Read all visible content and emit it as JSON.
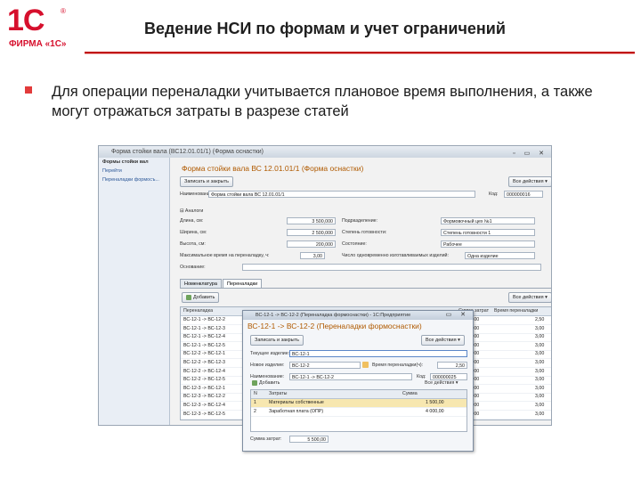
{
  "logo": {
    "brand": "1С",
    "reg_mark": "®",
    "subtitle": "ФИРМА «1С»"
  },
  "slide": {
    "title": "Ведение НСИ по формам и учет ограничений",
    "bullet": "Для операции переналадки учитывается плановое время выполнения, а также могут отражаться затраты в разрезе статей"
  },
  "window": {
    "title": "Форма стойки вала (ВС12.01.01/1) (Форма оснастки)",
    "nav": {
      "header": "Формы стойки вал",
      "goto": "Перейти",
      "link": "Переналадки формосъ..."
    },
    "form_title": "Форма стойки вала ВС 12.01.01/1 (Форма оснастки)",
    "actions": {
      "save_close": "Записать и закрыть",
      "more": "Все действия ▾"
    },
    "fields": {
      "name_label": "Наименование:",
      "name_value": "Форма стойки вала ВС 12.01.01/1",
      "code_label": "Код:",
      "code_value": "000000016",
      "analog_label": "Аналоги",
      "length_label": "Длина, см:",
      "length_value": "3 500,000",
      "width_label": "Ширина, см:",
      "width_value": "2 500,000",
      "height_label": "Высота, см:",
      "height_value": "200,000",
      "maxtime_label": "Максимальное время на переналадку, ч:",
      "maxtime_value": "3,00",
      "dept_label": "Подразделение:",
      "dept_value": "Формовочный цех №1",
      "ready_label": "Степень готовности:",
      "ready_value": "Степень готовности 1",
      "state_label": "Состояние:",
      "state_value": "Рабочее",
      "simul_label": "Число одновременно изготавливаемых изделий:",
      "simul_value": "Одна изделие",
      "basis_label": "Основание:"
    },
    "tabs": [
      "Номенклатура",
      "Переналадки"
    ],
    "grid_toolbar": {
      "add": "Добавить",
      "more": "Все действия ▾"
    },
    "grid": {
      "columns": [
        "Переналадка",
        "Сумма затрат",
        "Время переналадки"
      ],
      "rows": [
        {
          "name": "ВС-12-1 -> ВС-12-2",
          "sum": "5 500",
          "time": "2,50"
        },
        {
          "name": "ВС-12-1 -> ВС-12-3",
          "sum": "3 000",
          "time": "3,00"
        },
        {
          "name": "ВС-12-1 -> ВС-12-4",
          "sum": "3 000",
          "time": "3,00"
        },
        {
          "name": "ВС-12-1 -> ВС-12-5",
          "sum": "3 000",
          "time": "3,00"
        },
        {
          "name": "ВС-12-2 -> ВС-12-1",
          "sum": "3 000",
          "time": "3,00"
        },
        {
          "name": "ВС-12-2 -> ВС-12-3",
          "sum": "3 000",
          "time": "3,00"
        },
        {
          "name": "ВС-12-2 -> ВС-12-4",
          "sum": "3 000",
          "time": "3,00"
        },
        {
          "name": "ВС-12-2 -> ВС-12-5",
          "sum": "3 000",
          "time": "3,00"
        },
        {
          "name": "ВС-12-3 -> ВС-12-1",
          "sum": "3 000",
          "time": "3,00"
        },
        {
          "name": "ВС-12-3 -> ВС-12-2",
          "sum": "3 000",
          "time": "3,00"
        },
        {
          "name": "ВС-12-3 -> ВС-12-4",
          "sum": "3 000",
          "time": "3,00"
        },
        {
          "name": "ВС-12-3 -> ВС-12-5",
          "sum": "3 000",
          "time": "3,00"
        }
      ]
    }
  },
  "dialog": {
    "title": "ВС-12-1 -> ВС-12-2 (Переналадка формоснастки) - 1С:Предприятие",
    "heading": "ВС-12-1 -> ВС-12-2 (Переналадки формоснастки)",
    "actions": {
      "save_close": "Записать и закрыть",
      "more": "Все действия ▾"
    },
    "current_label": "Текущее изделие:",
    "current_value": "ВС-12-1",
    "new_label": "Новое изделие:",
    "new_value": "ВС-12-2",
    "time_label": "Время переналадки(ч):",
    "time_value": "2,50",
    "name_label": "Наименование:",
    "name_value": "ВС-12-1 -> ВС-12-2",
    "code_label": "Код:",
    "code_value": "000000025",
    "toolbar": {
      "add": "Добавить",
      "more": "Все действия ▾"
    },
    "columns": [
      "N",
      "Затраты",
      "Сумма"
    ],
    "rows": [
      {
        "n": "1",
        "cost": "Материалы собственные",
        "sum": "1 500,00"
      },
      {
        "n": "2",
        "cost": "Заработная плата (ОПР)",
        "sum": "4 000,00"
      }
    ],
    "total_label": "Сумма затрат:",
    "total_value": "5 500,00"
  }
}
